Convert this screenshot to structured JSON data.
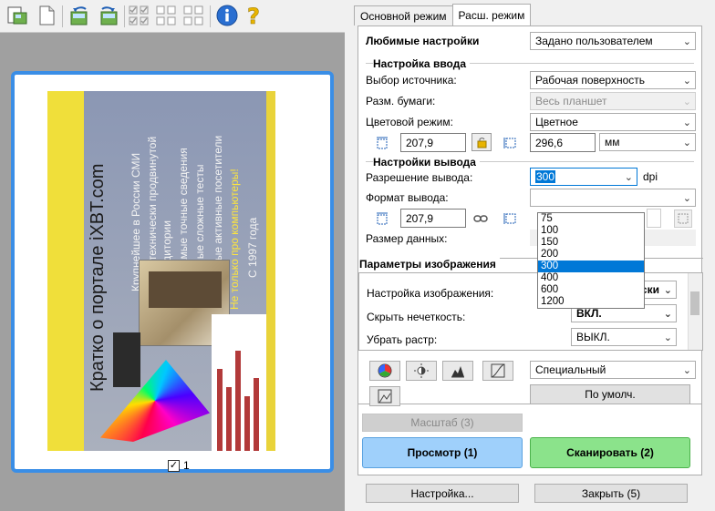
{
  "toolbar": {
    "icons": [
      "scan-mode-icon",
      "new-page-icon",
      "rotate-left-icon",
      "rotate-right-icon",
      "select-all-icon",
      "deselect-icon",
      "info-icon",
      "help-icon"
    ]
  },
  "preview": {
    "page_number": "1",
    "page_checked": true,
    "scan_title": "Кратко о портале iXBT.com",
    "scan_bullets": [
      "Крупнейшее в России СМИ",
      "для технически продвинутой",
      "аудитории",
      "Самые точные сведения",
      "Самые сложные тесты",
      "Самые активные посетители",
      "Не только про компьютеры!",
      "С 1997 года"
    ]
  },
  "tabs": [
    {
      "label": "Основной режим",
      "active": false
    },
    {
      "label": "Расш. режим",
      "active": true
    }
  ],
  "favorites": {
    "label": "Любимые настройки",
    "value": "Задано пользователем"
  },
  "input": {
    "title": "Настройка ввода",
    "source_label": "Выбор источника:",
    "source_value": "Рабочая поверхность",
    "paper_label": "Разм. бумаги:",
    "paper_value": "Весь планшет",
    "color_label": "Цветовой режим:",
    "color_value": "Цветное",
    "width": "207,9",
    "height": "296,6",
    "unit": "мм"
  },
  "output": {
    "title": "Настройки вывода",
    "resolution_label": "Разрешение вывода:",
    "resolution_value": "300",
    "resolution_unit": "dpi",
    "resolution_options": [
      "75",
      "100",
      "150",
      "200",
      "300",
      "400",
      "600",
      "1200"
    ],
    "resolution_selected": "300",
    "format_label": "Формат вывода:",
    "width": "207,9",
    "size_label": "Размер данных:"
  },
  "image": {
    "title": "Параметры изображения",
    "adjust_label": "Настройка изображения:",
    "adjust_value": "Автоматически",
    "unsharp_label": "Скрыть нечеткость:",
    "unsharp_value": "ВКЛ.",
    "descreen_label": "Убрать растр:",
    "descreen_value": "ВЫКЛ."
  },
  "color_settings": {
    "value": "Специальный",
    "default_label": "По умолч."
  },
  "buttons": {
    "zoom": "Масштаб (3)",
    "preview": "Просмотр (1)",
    "scan": "Сканировать (2)",
    "preferences": "Настройка...",
    "close": "Закрыть (5)"
  },
  "colors": {
    "accent": "#3a8ee6",
    "preview_btn": "#9fd0fb",
    "scan_btn": "#8be38b",
    "selection": "#0078d7"
  }
}
